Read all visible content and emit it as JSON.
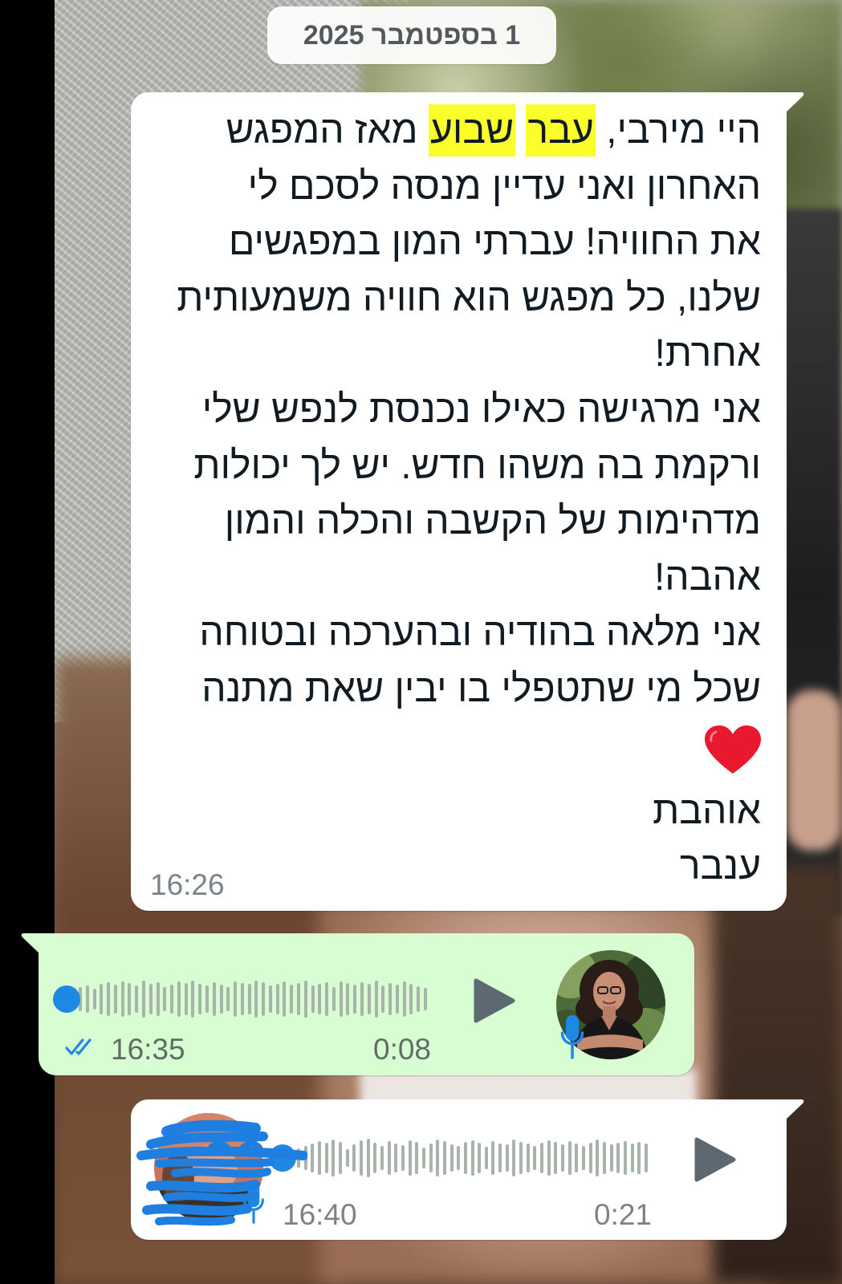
{
  "colors": {
    "outgoing_bubble": "#d9fdd3",
    "incoming_bubble": "#ffffff",
    "accent_blue": "#1e88e5",
    "highlight": "#faff2b",
    "meta_text": "#7b8389",
    "waveform": "#a7b3ab",
    "play_icon": "#5d6870",
    "redaction": "#1f7fe0"
  },
  "date_chip": "1 בספטמבר 2025",
  "text_message": {
    "line_1": {
      "start": "היי מירבי,",
      "highlight_1": "עבר",
      "highlight_2": "שבוע",
      "end": "מאז המפגש"
    },
    "lines": [
      "האחרון ואני עדיין מנסה לסכם לי",
      "את החוויה! עברתי המון במפגשים",
      "שלנו, כל מפגש הוא חוויה משמעותית",
      "אחרת!",
      "אני מרגישה כאילו נכנסת לנפש שלי",
      "ורקמת בה משהו חדש. יש לך יכולות",
      "מדהימות של הקשבה והכלה והמון",
      "אהבה!",
      "אני מלאה בהודיה ובהערכה ובטוחה",
      "שכל מי שתטפלי בו יבין שאת מתנה"
    ],
    "heart_icon": "red-heart-emoji",
    "closing": [
      "אוהבת",
      "ענבר"
    ],
    "time": "16:26"
  },
  "voice_sent": {
    "time": "16:35",
    "duration": "0:08",
    "progress": 0,
    "status_icon": "double-check-read-icon",
    "play_icon": "play-icon",
    "mic_icon": "mic-icon",
    "avatar_icon": "contact-photo"
  },
  "voice_received": {
    "time": "16:40",
    "duration": "0:21",
    "progress": 0,
    "play_icon": "play-icon",
    "mic_icon": "mic-icon",
    "avatar_icon": "redacted-contact-photo"
  }
}
